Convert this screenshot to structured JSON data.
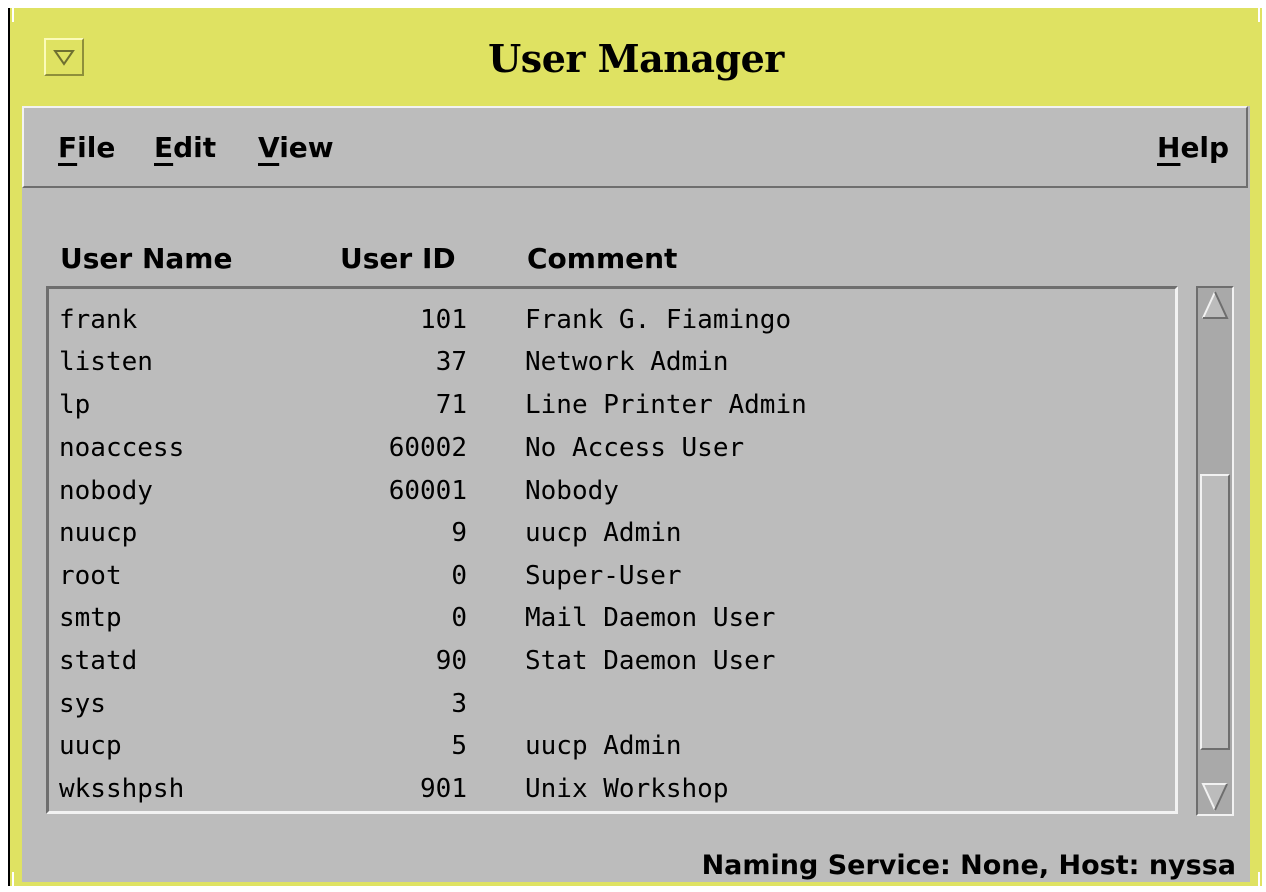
{
  "window": {
    "title": "User Manager"
  },
  "menubar": {
    "file": {
      "mnemonic": "F",
      "rest": "ile"
    },
    "edit": {
      "mnemonic": "E",
      "rest": "dit"
    },
    "view": {
      "mnemonic": "V",
      "rest": "iew"
    },
    "help": {
      "mnemonic": "H",
      "rest": "elp"
    }
  },
  "columns": {
    "name": "User Name",
    "id": "User ID",
    "comment": "Comment"
  },
  "users": [
    {
      "name": "frank",
      "id": "101",
      "comment": "Frank G. Fiamingo"
    },
    {
      "name": "listen",
      "id": "37",
      "comment": "Network Admin"
    },
    {
      "name": "lp",
      "id": "71",
      "comment": "Line Printer Admin"
    },
    {
      "name": "noaccess",
      "id": "60002",
      "comment": "No Access User"
    },
    {
      "name": "nobody",
      "id": "60001",
      "comment": "Nobody"
    },
    {
      "name": "nuucp",
      "id": "9",
      "comment": "uucp Admin"
    },
    {
      "name": "root",
      "id": "0",
      "comment": "Super-User"
    },
    {
      "name": "smtp",
      "id": "0",
      "comment": "Mail Daemon User"
    },
    {
      "name": "statd",
      "id": "90",
      "comment": "Stat Daemon User"
    },
    {
      "name": "sys",
      "id": "3",
      "comment": ""
    },
    {
      "name": "uucp",
      "id": "5",
      "comment": "uucp Admin"
    },
    {
      "name": "wksshpsh",
      "id": "901",
      "comment": "Unix Workshop"
    }
  ],
  "status": "Naming Service: None, Host: nyssa",
  "colors": {
    "titlebar": "#dfe262",
    "panel": "#bcbcbc",
    "scroll_trough": "#a9a9a9"
  },
  "icons": {
    "window_menu": "triangle-down-icon",
    "scroll_up": "arrow-up-icon",
    "scroll_down": "arrow-down-icon"
  }
}
